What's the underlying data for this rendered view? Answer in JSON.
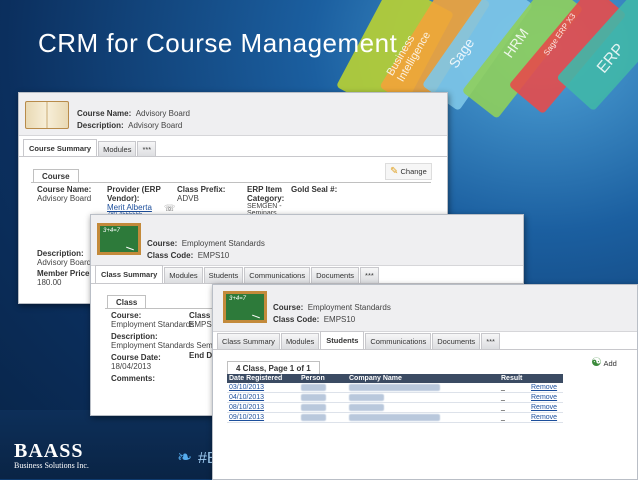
{
  "slide": {
    "title": "CRM for Course Management",
    "hashtag": "#B",
    "logo_main": "BAASS",
    "logo_sub": "Business Solutions Inc.",
    "ribbon_labels": [
      "Business Intelligence",
      "Sage",
      "HRM",
      "Sage ERP X3",
      "ERP"
    ]
  },
  "win1": {
    "course_name_label": "Course Name:",
    "course_name_value": "Advisory Board",
    "description_label": "Description:",
    "description_value": "Advisory Board",
    "tabs": [
      "Course Summary",
      "Modules",
      "***"
    ],
    "change_label": "Change",
    "section_title": "Course",
    "fields": {
      "course_name_label": "Course Name:",
      "course_name_value": "Advisory Board",
      "provider_label": "Provider (ERP Vendor):",
      "provider_value": "Merit Alberta",
      "provider_phone": "780-4555555",
      "class_prefix_label": "Class Prefix:",
      "class_prefix_value": "ADVB",
      "erp_item_label": "ERP Item Category:",
      "erp_item_value": "SEMGEN - Seminars",
      "gold_seal_label": "Gold Seal #:",
      "description_label": "Description:",
      "description_value": "Advisory Board",
      "member_price_label": "Member Price",
      "member_price_value": "180.00"
    }
  },
  "win2": {
    "course_label": "Course:",
    "course_value": "Employment Standards",
    "class_code_label": "Class Code:",
    "class_code_value": "EMPS10",
    "tabs": [
      "Class Summary",
      "Modules",
      "Students",
      "Communications",
      "Documents",
      "***"
    ],
    "section_title": "Class",
    "fields": {
      "course_label": "Course:",
      "course_value": "Employment Standards",
      "class_label": "Class C",
      "class_value": "EMPS10",
      "description_label": "Description:",
      "description_value": "Employment Standards Seminar",
      "course_date_label": "Course Date:",
      "course_date_value": "18/04/2013",
      "end_date_label": "End Da",
      "comments_label": "Comments:"
    }
  },
  "win3": {
    "course_label": "Course:",
    "course_value": "Employment Standards",
    "class_code_label": "Class Code:",
    "class_code_value": "EMPS10",
    "tabs": [
      "Class Summary",
      "Modules",
      "Students",
      "Communications",
      "Documents",
      "***"
    ],
    "add_label": "Add",
    "grid_title": "4 Class, Page 1 of 1",
    "columns": [
      "Date Registered",
      "Person",
      "Company Name",
      "Result",
      ""
    ],
    "rows": [
      {
        "date": "03/10/2013",
        "remove": "Remove"
      },
      {
        "date": "04/10/2013",
        "remove": "Remove"
      },
      {
        "date": "08/10/2013",
        "remove": "Remove"
      },
      {
        "date": "09/10/2013",
        "remove": "Remove"
      }
    ]
  },
  "board_text": "3+4=7"
}
